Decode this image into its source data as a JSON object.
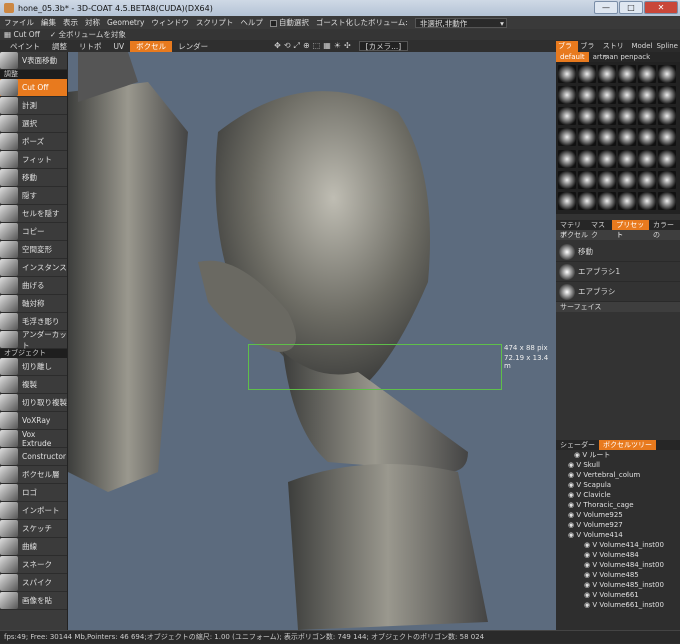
{
  "window": {
    "title": "hone_05.3b* - 3D-COAT 4.5.BETA8(CUDA)(DX64)",
    "min": "—",
    "max": "□",
    "close": "✕"
  },
  "menu": {
    "items": [
      "ファイル",
      "編集",
      "表示",
      "対称",
      "Geometry",
      "ウィンドウ",
      "スクリプト",
      "ヘルプ"
    ],
    "auto_select": "自動選択",
    "ghost_label": "ゴースト化したボリューム:",
    "ghost_value": "非選択,非動作"
  },
  "options": {
    "cutoff": "Cut Off",
    "all_volumes": "全ボリュームを対象"
  },
  "tabs": [
    "ペイント",
    "調整",
    "リトポ",
    "UV",
    "ボクセル",
    "レンダー"
  ],
  "active_tab": "ボクセル",
  "camera": "[カメラ...]",
  "left_tools": {
    "top": [
      "V表面移動"
    ],
    "section_adjust": "調整",
    "adjust": [
      "Cut Off",
      "計測",
      "選択",
      "ポーズ",
      "フィット",
      "移動",
      "隠す",
      "セルを隠す",
      "コピー",
      "空間変形",
      "インスタンス",
      "曲げる",
      "軸対称",
      "毛浮き彫り",
      "アンダーカット"
    ],
    "section_object": "オブジェクト",
    "object": [
      "切り離し",
      "複製",
      "切り取り複製",
      "VoXRay",
      "Vox Extrude",
      "Constructor",
      "ボクセル層",
      "ロゴ",
      "インポート",
      "スケッチ",
      "曲線",
      "スネーク",
      "スパイク",
      "画像を貼"
    ]
  },
  "viewport": {
    "size_px": "474 x 88 pix",
    "size_m": "72.19 x 13.4 m"
  },
  "right_panel": {
    "tabs": [
      "ブラシ",
      "ブラシ",
      "ストリッ",
      "Model",
      "Spline"
    ],
    "brush_sets": [
      "default",
      "artman penpack"
    ],
    "sub_tabs": [
      "マテリア",
      "マスク",
      "プリセット",
      "カラーの"
    ],
    "voxel_group": "ボクセル",
    "presets": [
      "移動",
      "エアブラシ1",
      "エアブラシ"
    ],
    "surface_group": "サーフェイス",
    "tree_tabs": [
      "シェーダー",
      "ボクセルツリー"
    ],
    "tree": [
      "ルート",
      "Skull",
      "Vertebral_colum",
      "Scapula",
      "Clavicle",
      "Thoracic_cage",
      "Volume925",
      "Volume927",
      "Volume414",
      "Volume414_inst00",
      "Volume484",
      "Volume484_inst00",
      "Volume485",
      "Volume485_inst00",
      "Volume661",
      "Volume661_inst00"
    ]
  },
  "status": "fps:49;     Free: 30144 Mb,Pointers: 46 694;オブジェクトの縮尺: 1.00 (ユニフォーム); 表示ポリゴン数: 749 144; オブジェクトのポリゴン数: 58 024"
}
